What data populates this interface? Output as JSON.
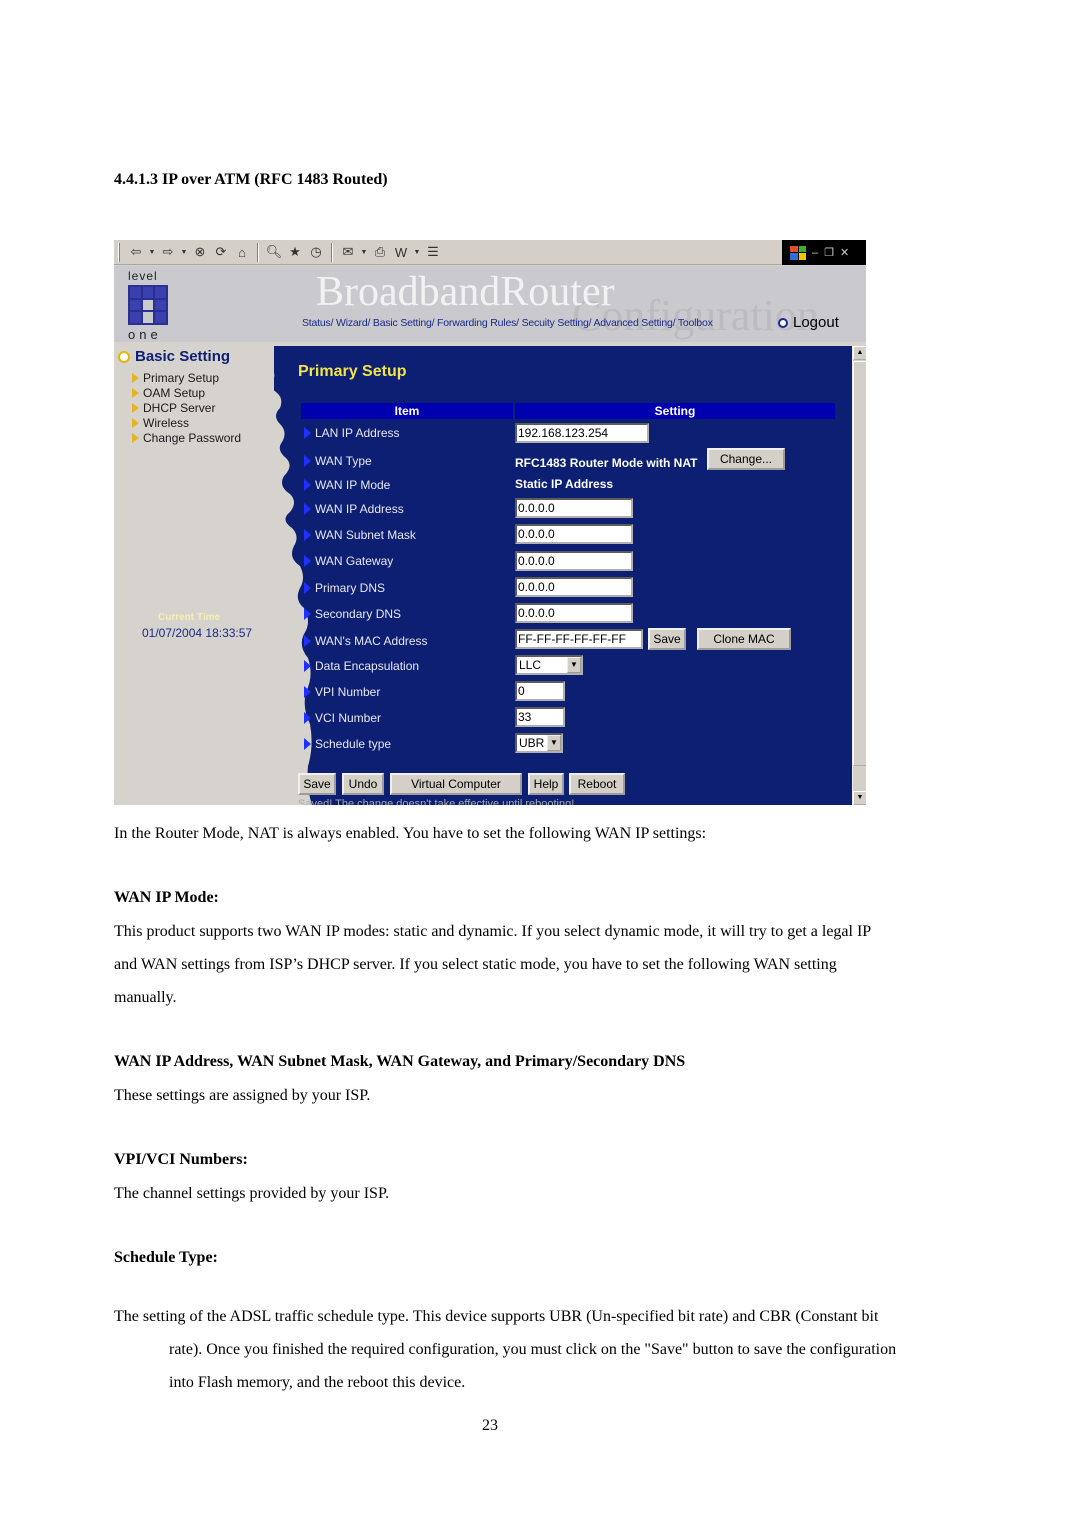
{
  "doc": {
    "section_heading": "4.4.1.3 IP over ATM (RFC 1483 Routed)",
    "intro": "In the Router Mode, NAT is always enabled. You have to set the following WAN IP settings:",
    "wan_ip_mode_heading": "WAN IP Mode:",
    "wan_ip_mode_text": "This product supports two WAN IP modes: static and dynamic. If you select dynamic mode, it will try to get a legal IP and WAN settings from ISP’s DHCP server. If you select static mode, you have to set the following WAN setting manually.",
    "wan_fields_heading": "WAN IP Address, WAN Subnet Mask, WAN Gateway, and Primary/Secondary DNS",
    "wan_fields_text": "These settings are assigned by your ISP.",
    "vpi_vci_heading": "VPI/VCI Numbers:",
    "vpi_vci_text": "The channel settings provided by your ISP.",
    "schedule_heading": "Schedule Type:",
    "schedule_text": "The setting of the ADSL traffic schedule type. This device supports UBR (Un-specified bit rate) and CBR (Constant bit rate). Once you finished the required configuration, you must click on the \"Save\" button to save the configuration into Flash memory, and the reboot this device.",
    "page_number": "23"
  },
  "screenshot": {
    "toolbar": {
      "icons": [
        "back-icon",
        "forward-icon",
        "stop-icon",
        "refresh-icon",
        "home-icon",
        "search-icon",
        "favorites-icon",
        "history-icon",
        "mail-icon",
        "print-icon",
        "word-icon",
        "discuss-icon"
      ],
      "window_controls": [
        "minimize",
        "restore",
        "close"
      ]
    },
    "banner": {
      "logo_top": "level",
      "logo_bottom": "one",
      "brand": "BroadbandRouter",
      "brand_sub": "Configuration",
      "nav": [
        "Status/",
        "Wizard/",
        "Basic Setting/",
        "Forwarding Rules/",
        "Secuity Setting/",
        "Advanced Setting/",
        "Toolbox"
      ],
      "logout": "Logout"
    },
    "sidebar": {
      "title": "Basic Setting",
      "items": [
        "Primary Setup",
        "OAM Setup",
        "DHCP Server",
        "Wireless",
        "Change Password"
      ],
      "current_time_label": "Current Time",
      "current_time": "01/07/2004 18:33:57"
    },
    "main": {
      "title": "Primary Setup",
      "col_item": "Item",
      "col_setting": "Setting",
      "rows": {
        "lan_ip": {
          "label": "LAN IP Address",
          "value": "192.168.123.254"
        },
        "wan_type": {
          "label": "WAN Type",
          "value": "RFC1483 Router Mode with NAT",
          "button": "Change..."
        },
        "wan_ip_mode": {
          "label": "WAN IP Mode",
          "value": "Static IP Address"
        },
        "wan_ip": {
          "label": "WAN IP Address",
          "value": "0.0.0.0"
        },
        "wan_mask": {
          "label": "WAN Subnet Mask",
          "value": "0.0.0.0"
        },
        "wan_gw": {
          "label": "WAN Gateway",
          "value": "0.0.0.0"
        },
        "dns1": {
          "label": "Primary DNS",
          "value": "0.0.0.0"
        },
        "dns2": {
          "label": "Secondary DNS",
          "value": "0.0.0.0"
        },
        "mac": {
          "label": "WAN's MAC Address",
          "value": "FF-FF-FF-FF-FF-FF",
          "save": "Save",
          "clone": "Clone MAC"
        },
        "encap": {
          "label": "Data Encapsulation",
          "value": "LLC"
        },
        "vpi": {
          "label": "VPI Number",
          "value": "0"
        },
        "vci": {
          "label": "VCI Number",
          "value": "33"
        },
        "sched": {
          "label": "Schedule type",
          "value": "UBR"
        }
      },
      "buttons": {
        "save": "Save",
        "undo": "Undo",
        "virtual": "Virtual Computer",
        "help": "Help",
        "reboot": "Reboot"
      },
      "saved_message": "Saved! The change doesn't take effective until rebooting!"
    }
  }
}
